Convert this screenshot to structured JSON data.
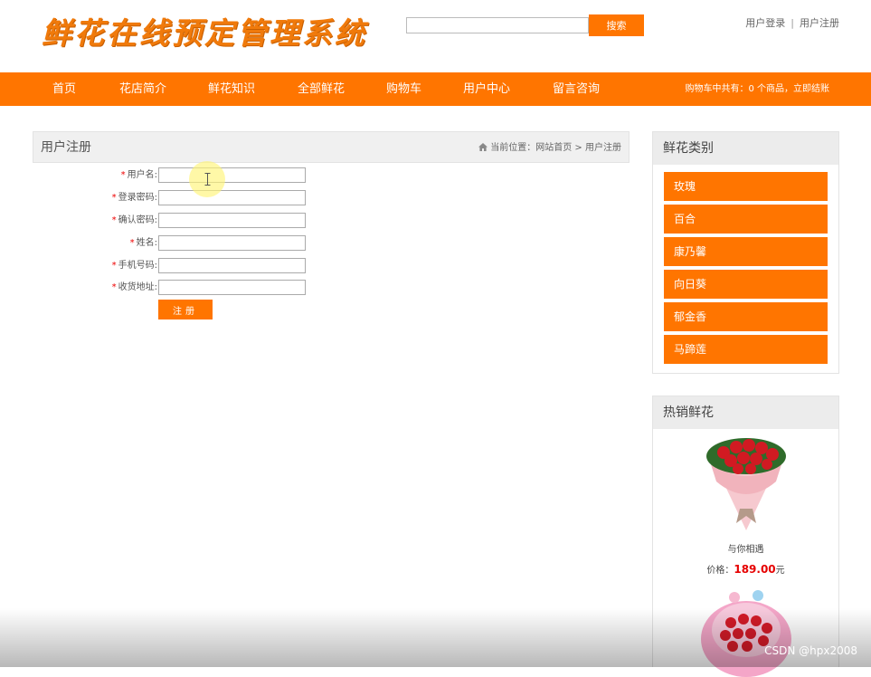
{
  "site": {
    "logo_text": "鲜花在线预定管理系统"
  },
  "search": {
    "placeholder": "",
    "button_label": "搜索"
  },
  "top_links": {
    "login": "用户登录",
    "separator": "|",
    "register": "用户注册"
  },
  "nav": {
    "items": [
      "首页",
      "花店简介",
      "鲜花知识",
      "全部鲜花",
      "购物车",
      "用户中心",
      "留言咨询"
    ],
    "cart_summary": "购物车中共有：0 个商品，立即结账"
  },
  "main": {
    "title": "用户注册",
    "breadcrumb": {
      "prefix": "当前位置：",
      "home": "网站首页",
      "separator": ">",
      "current": "用户注册"
    },
    "form": {
      "required_mark": "*",
      "fields": [
        {
          "label": "用户名:",
          "value": ""
        },
        {
          "label": "登录密码:",
          "value": ""
        },
        {
          "label": "确认密码:",
          "value": ""
        },
        {
          "label": "姓名:",
          "value": ""
        },
        {
          "label": "手机号码:",
          "value": ""
        },
        {
          "label": "收货地址:",
          "value": ""
        }
      ],
      "submit_label": "注册"
    }
  },
  "sidebar": {
    "categories_title": "鲜花类别",
    "categories": [
      "玫瑰",
      "百合",
      "康乃馨",
      "向日葵",
      "郁金香",
      "马蹄莲"
    ],
    "hot_title": "热销鲜花",
    "products": [
      {
        "name": "与你相遇",
        "price_prefix": "价格：",
        "price": "189.00",
        "price_suffix": "元"
      }
    ]
  },
  "watermark": "CSDN @hpx2008",
  "colors": {
    "accent": "#ff7500",
    "price": "#e60000"
  }
}
